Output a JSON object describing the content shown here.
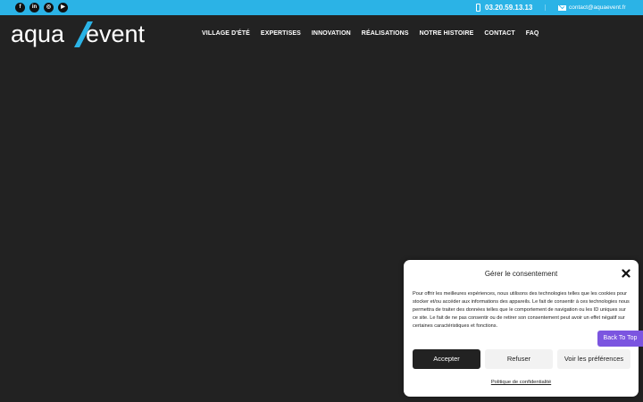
{
  "topbar": {
    "social": [
      {
        "name": "facebook",
        "glyph": "f"
      },
      {
        "name": "linkedin",
        "glyph": "in"
      },
      {
        "name": "instagram",
        "glyph": "◎"
      },
      {
        "name": "youtube",
        "glyph": "▶"
      }
    ],
    "phone": "03.20.59.13.13",
    "email": "contact@aquaevent.fr",
    "background_color": "#2bb3e6"
  },
  "logo": {
    "part1": "aqua",
    "part2": "event",
    "text_color": "#ffffff",
    "accent_color": "#2bb3e6"
  },
  "nav": {
    "items": [
      "VILLAGE D'ÉTÉ",
      "EXPERTISES",
      "INNOVATION",
      "RÉALISATIONS",
      "NOTRE HISTOIRE",
      "CONTACT",
      "FAQ"
    ]
  },
  "consent": {
    "title": "Gérer le consentement",
    "text": "Pour offrir les meilleures expériences, nous utilisons des technologies telles que les cookies pour stocker et/ou accéder aux informations des appareils. Le fait de consentir à ces technologies nous permettra de traiter des données telles que le comportement de navigation ou les ID uniques sur ce site. Le fait de ne pas consentir ou de retirer son consentement peut avoir un effet négatif sur certaines caractéristiques et fonctions.",
    "accept_label": "Accepter",
    "refuse_label": "Refuser",
    "preferences_label": "Voir les préférences",
    "policy_label": "Politique de confidentialité"
  },
  "back_to_top": "Back To Top",
  "colors": {
    "page_background": "#222222",
    "accent_purple": "#7b55e0"
  }
}
